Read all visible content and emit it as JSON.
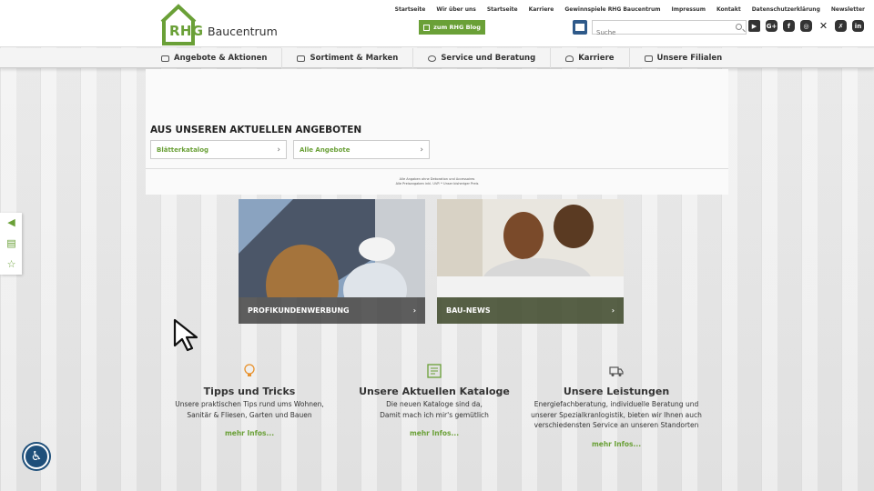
{
  "logo": {
    "brand": "RHG",
    "name": "Baucentrum"
  },
  "topnav": [
    "Startseite",
    "Wir über uns",
    "Startseite",
    "Karriere",
    "Gewinnspiele RHG Baucentrum",
    "Impressum",
    "Kontakt",
    "Datenschutzerklärung",
    "Newsletter"
  ],
  "blog_button": "zum RHG Blog",
  "search": {
    "placeholder": "Suche"
  },
  "socials": [
    "youtube-icon",
    "google-plus-icon",
    "facebook-icon",
    "instagram-icon",
    "x-icon",
    "xing-icon",
    "linkedin-icon"
  ],
  "mainnav": [
    "Angebote & Aktionen",
    "Sortiment & Marken",
    "Service und Beratung",
    "Karriere",
    "Unsere Filialen"
  ],
  "offers": {
    "title": "AUS UNSEREN AKTUELLEN ANGEBOTEN",
    "buttons": [
      "Blätterkatalog",
      "Alle Angebote"
    ],
    "disclaimer_1": "Alle Angaben ohne Dekoration und Accessoires",
    "disclaimer_2": "Alle Preisangaben inkl. UVP. * Unser bisheriger Preis"
  },
  "promos": [
    "PROFIKUNDENWERBUNG",
    "BAU-NEWS"
  ],
  "features": [
    {
      "title": "Tipps und Tricks",
      "lines": [
        "Unsere praktischen Tips rund ums Wohnen,",
        "Sanitär & Fliesen, Garten und Bauen"
      ],
      "more": "mehr Infos..."
    },
    {
      "title": "Unsere Aktuellen Kataloge",
      "lines": [
        "Die neuen Kataloge sind da,",
        "Damit mach ich mir's gemütlich"
      ],
      "more": "mehr Infos..."
    },
    {
      "title": "Unsere Leistungen",
      "lines": [
        "Energiefachberatung, individuelle Beratung und",
        "unserer Spezialkranlogistik, bieten wir Ihnen auch",
        "verschiedensten Service an unseren Standorten"
      ],
      "more": "mehr Infos..."
    }
  ],
  "colors": {
    "brand_green": "#6aa037",
    "dark": "#333333",
    "access_blue": "#1e4f7a"
  }
}
